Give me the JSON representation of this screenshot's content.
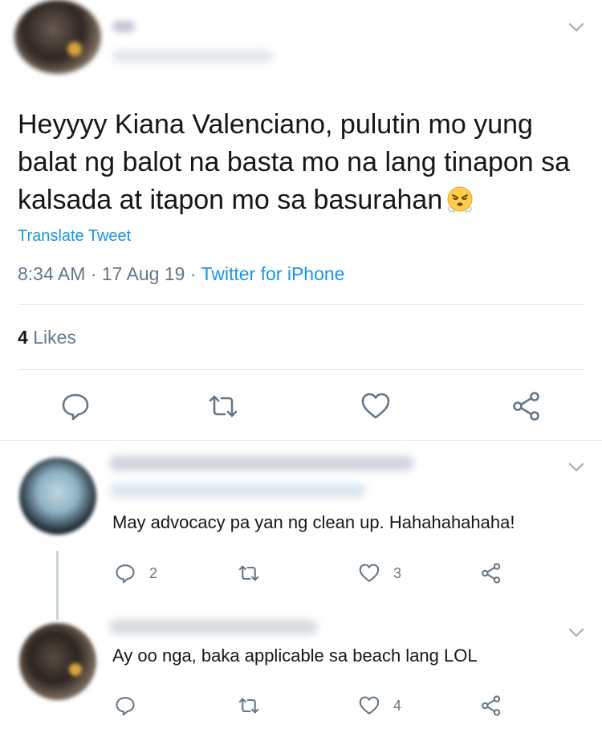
{
  "tweet": {
    "text": "Heyyyy Kiana Valenciano, pulutin mo yung balat ng balot na basta mo na lang tinapon sa kalsada at itapon mo sa basurahan",
    "emoji": "face-with-steam-from-nose",
    "translate_label": "Translate Tweet",
    "time": "8:34 AM",
    "sep1": " · ",
    "date": "17 Aug 19",
    "sep2": " · ",
    "source": "Twitter for iPhone",
    "likes_count": "4",
    "likes_label": "Likes"
  },
  "replies": [
    {
      "text": "May advocacy pa yan ng clean up. Hahahahahaha!",
      "reply_count": "2",
      "like_count": "3"
    },
    {
      "text": "Ay oo nga, baka applicable sa beach lang LOL",
      "like_count": "4"
    }
  ],
  "colors": {
    "link": "#1b95e0",
    "secondary_text": "#657786",
    "icon": "#657786",
    "divider": "#e1e8ed"
  },
  "icons": [
    "chevron-down-icon",
    "reply-icon",
    "retweet-icon",
    "like-icon",
    "share-icon"
  ]
}
